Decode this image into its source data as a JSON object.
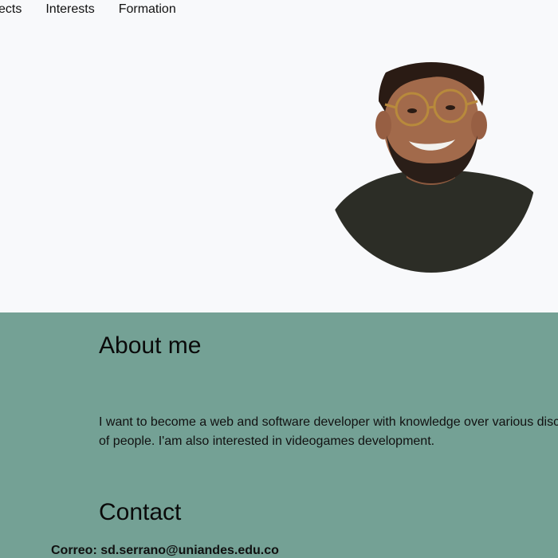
{
  "nav": {
    "items": [
      "yects",
      "Interests",
      "Formation"
    ]
  },
  "hero": {
    "photo_alt": "profile-photo"
  },
  "about": {
    "heading": "About me",
    "bio_line1": "I want to become a web and software developer with knowledge over various disc",
    "bio_line2": "of people. I'am also interested in videogames development."
  },
  "contact": {
    "heading": "Contact",
    "email_line": "Correo: sd.serrano@uniandes.edu.co"
  },
  "colors": {
    "page_bg": "#f8f9fb",
    "section_bg": "#74a195"
  }
}
